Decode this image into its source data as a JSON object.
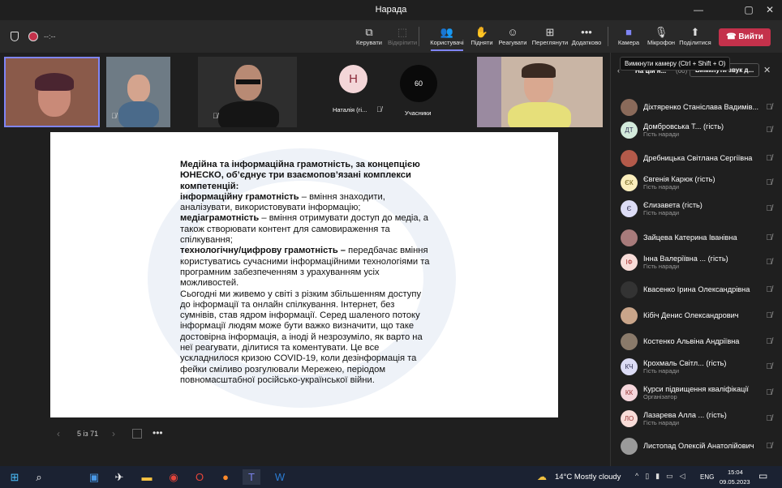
{
  "window": {
    "title": "Нарада",
    "min": "—",
    "max": "▢",
    "close": "✕"
  },
  "status": {
    "timer": "--:--"
  },
  "toolbar": {
    "items": [
      {
        "label": "Керувати",
        "icon": "⧉"
      },
      {
        "label": "Відкріпити",
        "icon": "⬚"
      },
      {
        "label": "Користувачі",
        "icon": "👥"
      },
      {
        "label": "Підняти",
        "icon": "✋"
      },
      {
        "label": "Реагувати",
        "icon": "☺"
      },
      {
        "label": "Переглянути",
        "icon": "⊞"
      },
      {
        "label": "Додатково",
        "icon": "•••"
      },
      {
        "label": "Камера",
        "icon": "■"
      },
      {
        "label": "Мікрофон",
        "icon": "🎙"
      },
      {
        "label": "Поділитися",
        "icon": "⬆"
      }
    ],
    "leave": "Вийти"
  },
  "tooltip": "Вимкнути камеру (Ctrl + Shift + O)",
  "videos": {
    "avatar_initial": "Н",
    "avatar_name": "Наталія (гі...",
    "count": "60",
    "count_label": "Учасники"
  },
  "panel": {
    "header": "На цій н...",
    "header_count": "(60)",
    "mute_all": "Вимкнути звук д...",
    "close": "✕",
    "participants": [
      {
        "name": "Діхтяренко Станіслава Вадимів...",
        "initials": "",
        "bg": "#8a6a5a",
        "sub": ""
      },
      {
        "name": "Домбровська Т...  (гість)",
        "initials": "ДТ",
        "bg": "#d3eadb",
        "fg": "#335",
        "sub": "Гість наради"
      },
      {
        "name": "Дребницька Світлана Сергіївна",
        "initials": "",
        "bg": "#b45a4a",
        "sub": ""
      },
      {
        "name": "Євгенія Карюк (гість)",
        "initials": "ЄК",
        "bg": "#fbeebc",
        "fg": "#6a5a10",
        "sub": "Гість наради"
      },
      {
        "name": "Єлизавета (гість)",
        "initials": "Є",
        "bg": "#dcdcf5",
        "fg": "#335",
        "sub": "Гість наради"
      },
      {
        "name": "Зайцева Катерина Іванівна",
        "initials": "",
        "bg": "#a87b7b",
        "sub": ""
      },
      {
        "name": "Інна Валеріївна ... (гість)",
        "initials": "ІФ",
        "bg": "#f8dcd8",
        "fg": "#a33",
        "sub": "Гість наради"
      },
      {
        "name": "Квасенко Ірина Олександрівна",
        "initials": "",
        "bg": "#333",
        "sub": ""
      },
      {
        "name": "Кібіч Денис Олександрович",
        "initials": "",
        "bg": "#c9a58a",
        "sub": ""
      },
      {
        "name": "Костенко Альвіна Андріївна",
        "initials": "",
        "bg": "#8a7a6a",
        "sub": ""
      },
      {
        "name": "Крохмаль Світл...  (гість)",
        "initials": "КЧ",
        "bg": "#dcdcf5",
        "fg": "#335",
        "sub": "Гість наради"
      },
      {
        "name": "Курси підвищення кваліфікації",
        "initials": "КК",
        "bg": "#f6d6dc",
        "fg": "#933",
        "sub": "Організатор"
      },
      {
        "name": "Лазарева Алла ...  (гість)",
        "initials": "ЛО",
        "bg": "#f8dcd8",
        "fg": "#933",
        "sub": "Гість наради"
      },
      {
        "name": "Листопад Олексій Анатолійович",
        "initials": "",
        "bg": "#9a9a9a",
        "sub": ""
      }
    ]
  },
  "slide": {
    "paragraphs": [
      {
        "bold": "Медійна та інформаційна грамотність, за концепцією ЮНЕСКО, об’єднує три взаємопов’язані комплекси компетенцій:",
        "text": ""
      },
      {
        "bold": "інформаційну грамотність",
        "text": " – вміння знаходити, аналізувати, використовувати інформацію;"
      },
      {
        "bold": "медіаграмотність",
        "text": " – вміння отримувати доступ до медіа, а також створювати контент для самовираження та спілкування;"
      },
      {
        "bold": "технологічну/цифрову грамотність –",
        "text": " передбачає вміння користуватись сучасними інформаційними технологіями та програмним забезпеченням з урахуванням усіх можливостей."
      },
      {
        "bold": "",
        "text": "Сьогодні ми живемо у світі з різким збільшенням доступу до інформації та онлайн спілкування. Інтернет, без сумнівів, став ядром інформації. Серед шаленого потоку інформації людям може бути важко визначити, що таке достовірна інформація, а іноді й незрозуміло, як варто на неї реагувати, ділитися та коментувати. Це все ускладнилося кризою COVID-19, коли дезінформація та фейки сміливо розгулювали Мережею, періодом повномасштабної російсько-української війни."
      }
    ],
    "page": "5 із 71"
  },
  "taskbar": {
    "weather": "14°C  Mostly cloudy",
    "lang": "ENG",
    "time": "15:04",
    "date": "09.05.2023"
  }
}
